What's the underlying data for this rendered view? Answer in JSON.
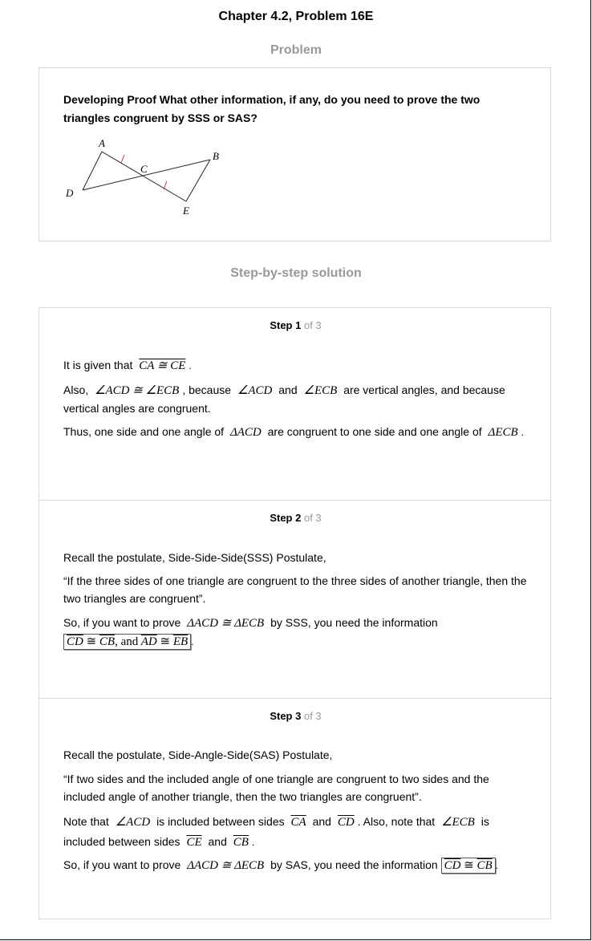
{
  "header": {
    "chapter_title": "Chapter 4.2, Problem 16E"
  },
  "problem": {
    "heading": "Problem",
    "text": "Developing Proof What other information, if any, do you need to prove the two triangles congruent by SSS or SAS?",
    "figure_labels": {
      "A": "A",
      "B": "B",
      "C": "C",
      "D": "D",
      "E": "E"
    }
  },
  "solution": {
    "heading": "Step-by-step solution",
    "step1": {
      "word": "Step 1",
      "of": "of 3",
      "p1_text": "It is given that",
      "p1_math": "CA ≅ CE",
      "p2_a": "Also,",
      "p2_math1": "∠ACD ≅ ∠ECB",
      "p2_b": ", because",
      "p2_math2": "∠ACD",
      "p2_c": "and",
      "p2_math3": "∠ECB",
      "p2_d": "are vertical angles, and because vertical angles are congruent.",
      "p3_a": "Thus, one side and one angle of",
      "p3_math1": "ΔACD",
      "p3_b": "are congruent to one side and one angle of",
      "p3_math2": "ΔECB"
    },
    "step2": {
      "word": "Step 2",
      "of": "of 3",
      "p1": "Recall the postulate, Side-Side-Side(SSS) Postulate,",
      "p2": "“If the three sides of one triangle are congruent to the three sides of another triangle, then the two triangles are congruent”.",
      "p3_a": "So, if you want to prove",
      "p3_math": "ΔACD ≅ ΔECB",
      "p3_b": "by SSS, you need the information",
      "box_seg1": "CD",
      "box_cong1": "≅",
      "box_seg2": "CB",
      "box_and": ", and",
      "box_seg3": "AD",
      "box_cong2": "≅",
      "box_seg4": "EB"
    },
    "step3": {
      "word": "Step 3",
      "of": "of 3",
      "p1": "Recall the postulate, Side-Angle-Side(SAS) Postulate,",
      "p2": "“If two sides and the included angle of one triangle are congruent to two sides and the included angle of another triangle, then the two triangles are congruent”.",
      "p3_a": "Note that",
      "p3_math1": "∠ACD",
      "p3_b": "is included between sides",
      "p3_seg1": "CA",
      "p3_c": "and",
      "p3_seg2": "CD",
      "p3_d": ". Also, note that",
      "p3_math2": "∠ECB",
      "p3_e": "is included between sides",
      "p3_seg3": "CE",
      "p3_f": "and",
      "p3_seg4": "CB",
      "p4_a": "So, if you want to prove",
      "p4_math": "ΔACD ≅ ΔECB",
      "p4_b": "by SAS, you need the information",
      "box_seg1": "CD",
      "box_cong": "≅",
      "box_seg2": "CB"
    }
  }
}
